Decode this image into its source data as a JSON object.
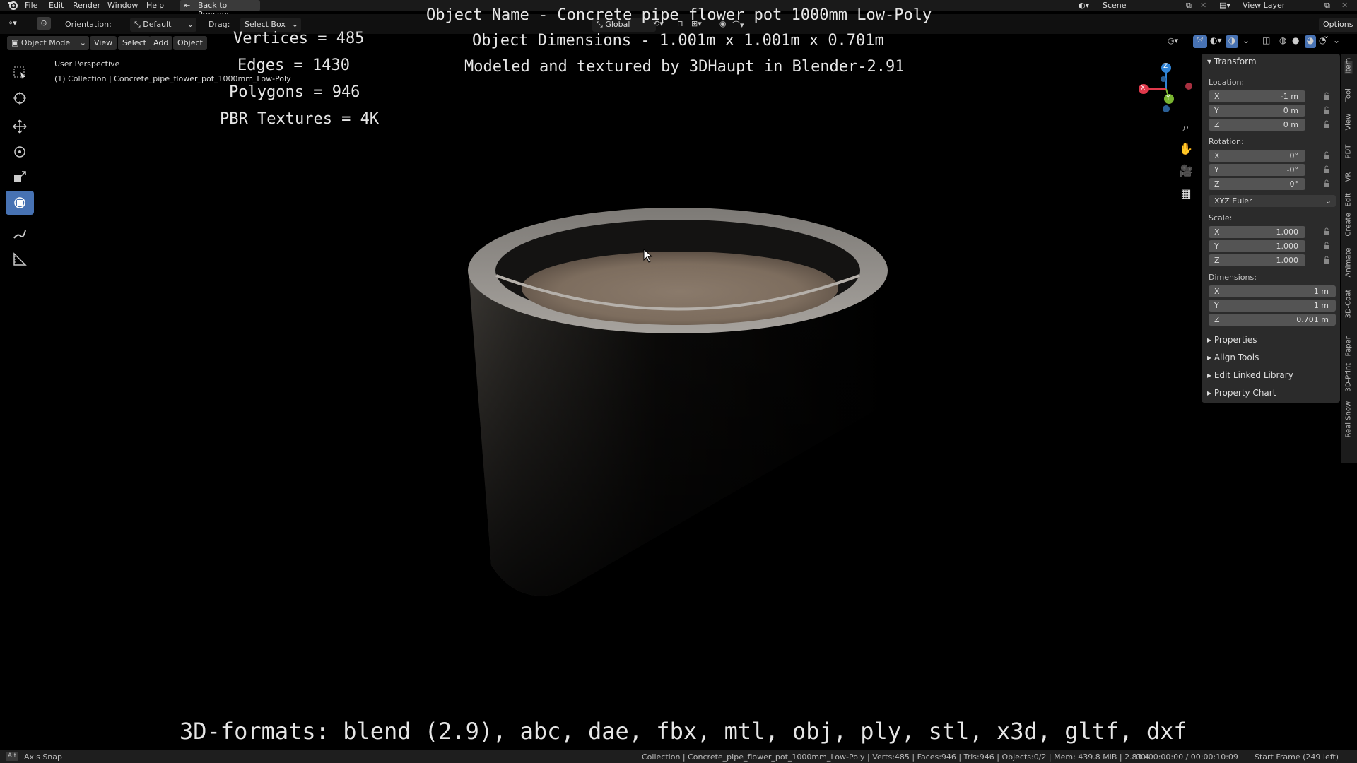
{
  "menu": {
    "items": [
      "File",
      "Edit",
      "Render",
      "Window",
      "Help"
    ],
    "back_button": "Back to Previous",
    "scene": "Scene",
    "view_layer": "View Layer"
  },
  "tool_header": {
    "orientation_label": "Orientation:",
    "orientation_value": "Default",
    "drag_label": "Drag:",
    "drag_value": "Select Box",
    "transform_space": "Global",
    "options": "Options"
  },
  "view_header": {
    "mode": "Object Mode",
    "view": "View",
    "select": "Select",
    "add": "Add",
    "object": "Object"
  },
  "viewport": {
    "perspective": "User Perspective",
    "collection": "(1) Collection | Concrete_pipe_flower_pot_1000mm_Low-Poly"
  },
  "overlay": {
    "vertices": "Vertices = 485",
    "edges": "Edges = 1430",
    "polygons": "Polygons = 946",
    "pbr": "PBR Textures = 4K",
    "object_name": "Object Name - Concrete pipe flower pot 1000mm Low-Poly",
    "object_dimensions": "Object Dimensions -  1.001m x 1.001m x 0.701m",
    "modeled_by": "Modeled and textured by 3DHaupt in Blender-2.91",
    "formats": "3D-formats: blend (2.9), abc, dae, fbx, mtl, obj, ply, stl, x3d, gltf, dxf"
  },
  "gizmo": {
    "x": "X",
    "y": "Y",
    "z": "Z"
  },
  "panel": {
    "title": "Transform",
    "location_label": "Location:",
    "location": {
      "x": "-1 m",
      "y": "0 m",
      "z": "0 m"
    },
    "rotation_label": "Rotation:",
    "rotation": {
      "x": "0°",
      "y": "-0°",
      "z": "0°"
    },
    "rotation_mode": "XYZ Euler",
    "scale_label": "Scale:",
    "scale": {
      "x": "1.000",
      "y": "1.000",
      "z": "1.000"
    },
    "dimensions_label": "Dimensions:",
    "dimensions": {
      "x": "1 m",
      "y": "1 m",
      "z": "0.701 m"
    },
    "axis": {
      "x": "X",
      "y": "Y",
      "z": "Z"
    },
    "sections": [
      "Properties",
      "Align Tools",
      "Edit Linked Library",
      "Property Chart"
    ]
  },
  "side_tabs": [
    "Item",
    "Tool",
    "View",
    "PDT",
    "VR",
    "Edit",
    "Create",
    "Animate",
    "3D-Coat",
    "Paper",
    "3D-Print",
    "Real Snow"
  ],
  "status": {
    "axis_snap": "Axis Snap",
    "stats": "Collection | Concrete_pipe_flower_pot_1000mm_Low-Poly | Verts:485 | Faces:946 | Tris:946 | Objects:0/2 | Mem: 439.8 MiB | 2.83.4",
    "time": "00:00:00:00 / 00:00:10:09",
    "start_frame": "Start Frame (249 left)"
  },
  "colors": {
    "accent": "#4772b3",
    "gizmo_x": "#e0394b",
    "gizmo_y": "#79b530",
    "gizmo_z": "#2f83d6"
  }
}
